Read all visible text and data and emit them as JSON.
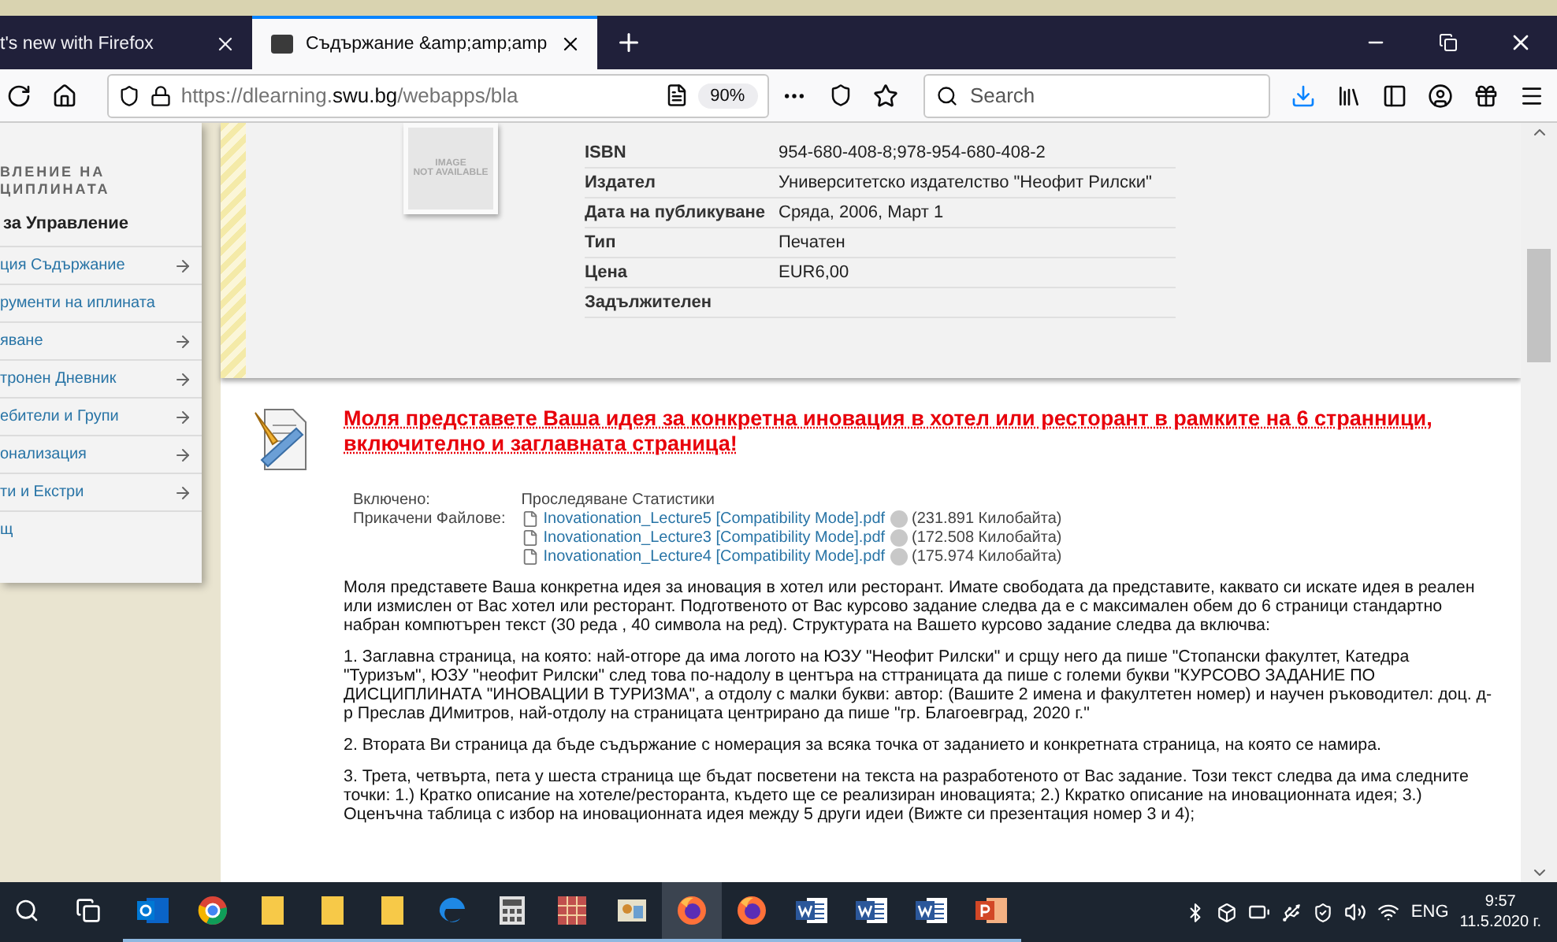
{
  "browser": {
    "tabs": [
      {
        "title": "t's new with Firefox",
        "selected": false
      },
      {
        "title": "Съдържание &amp;amp;amp",
        "selected": true
      }
    ],
    "url_prefix": "https://dlearning.",
    "url_domain": "swu.bg",
    "url_rest": "/webapps/bla",
    "zoom": "90%",
    "search": {
      "placeholder": "Search"
    }
  },
  "sidebar": {
    "heading_lines": [
      "ВЛЕНИЕ НА",
      "ЦИПЛИНАТА"
    ],
    "section": "за Управление",
    "items": [
      {
        "label": "ция Съдържание",
        "kind": "submenu"
      },
      {
        "label": "рументи на иплината",
        "kind": "link"
      },
      {
        "label": "яване",
        "kind": "submenu"
      },
      {
        "label": "тронен Дневник",
        "kind": "submenu"
      },
      {
        "label": "ебители и Групи",
        "kind": "submenu"
      },
      {
        "label": "онализация",
        "kind": "submenu"
      },
      {
        "label": "ти и Екстри",
        "kind": "submenu"
      },
      {
        "label": "щ",
        "kind": "link"
      }
    ]
  },
  "book": {
    "image_lines": [
      "IMAGE",
      "NOT AVAILABLE"
    ],
    "fields": [
      {
        "label": "ISBN",
        "value": "954-680-408-8;978-954-680-408-2"
      },
      {
        "label": "Издател",
        "value": "Университетско издателство \"Неофит Рилски\""
      },
      {
        "label": "Дата на публикуване",
        "value": "Сряда, 2006, Март 1"
      },
      {
        "label": "Тип",
        "value": "Печатен"
      },
      {
        "label": "Цена",
        "value": "EUR6,00"
      },
      {
        "label": "Задължителен"
      }
    ]
  },
  "assignment": {
    "title": "Моля представете Ваша идея за конкретна иновация в хотел или ресторант в рамките на 6 странници, включително и заглавната страница!",
    "included_label": "Включено:",
    "included_value": "Проследяване Статистики",
    "attachments_label": "Прикачени Файлове:",
    "files": [
      {
        "name": "Inovationation_Lecture5 [Compatibility Mode].pdf",
        "size": "(231.891 Килобайта)"
      },
      {
        "name": "Inovationation_Lecture3 [Compatibility Mode].pdf",
        "size": "(172.508 Килобайта)"
      },
      {
        "name": "Inovationation_Lecture4 [Compatibility Mode].pdf",
        "size": "(175.974 Килобайта)"
      }
    ],
    "paragraphs": [
      "Моля представете Ваша конкретна идея за иновация в хотел или ресторант. Имате свободата да представите, каквато си искате идея в реален или измислен от Вас хотел или ресторант. Подготвеното от Вас курсово задание следва да е с максимален обем до 6 страници стандартно набран компютърен текст (30 реда , 40 символа на ред). Структурата на Вашето курсово задание следва да включва:",
      "1. Заглавна страница, на която: най-отгоре да има логото на ЮЗУ \"Неофит Рилски\" и срщу него да пише \"Стопански факултет, Катедра \"Туризъм\", ЮЗУ \"неофит Рилски\" след това по-надолу в центъра на сттраницата да пише с големи букви \"КУРСОВО ЗАДАНИЕ ПО ДИСЦИПЛИНАТА \"ИНОВАЦИИ В ТУРИЗМА\", а отдолу с малки букви: автор: (Вашите 2 имена и факултетен номер) и научен ръководител: доц. д-р Преслав ДИмитров, най-отдолу на страницата центрирано да пише \"гр. Благоевград, 2020 г.\"",
      "2. Втората Ви страница да бъде съдържание с номерация за всяка точка от заданието и конкретната страница, на която се намира.",
      "3. Трета, четвърта, пета у шеста страница ще бъдат посветени на текста на разработеното от Вас задание. Този текст следва да има следните точки: 1.) Кратко описание на хотеле/ресторанта, където ще се реализиран иновацията; 2.) Ккратко описание на иновационната идея; 3.) Оценъчна таблица с избор на иновационната идея между 5 други идеи (Вижте си презентация номер 3 и 4);"
    ]
  },
  "taskbar": {
    "apps": [
      {
        "kind": "outlook",
        "selected": false
      },
      {
        "kind": "chrome",
        "selected": false
      },
      {
        "kind": "folder",
        "selected": false
      },
      {
        "kind": "folder",
        "selected": false
      },
      {
        "kind": "folder",
        "selected": false
      },
      {
        "kind": "edge",
        "selected": false
      },
      {
        "kind": "calculator",
        "selected": false
      },
      {
        "kind": "grid",
        "selected": false
      },
      {
        "kind": "photos",
        "selected": false
      },
      {
        "kind": "firefox",
        "selected": true
      },
      {
        "kind": "firefox",
        "selected": false
      },
      {
        "kind": "word",
        "selected": false
      },
      {
        "kind": "word",
        "selected": false
      },
      {
        "kind": "word",
        "selected": false
      },
      {
        "kind": "powerpoint",
        "selected": false
      }
    ],
    "language": "ENG",
    "time": "9:57",
    "date": "11.5.2020 г."
  }
}
